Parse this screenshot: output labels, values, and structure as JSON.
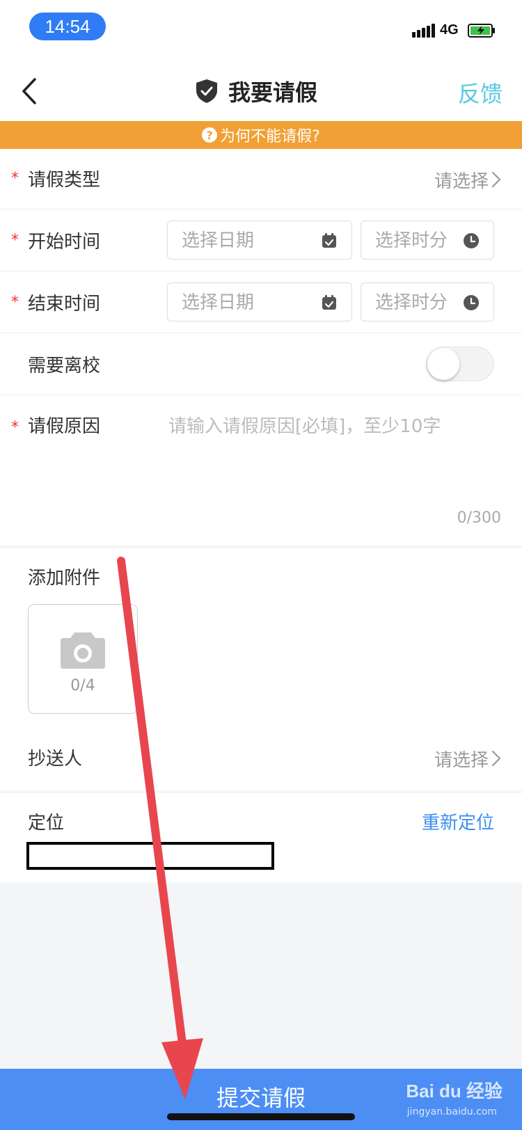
{
  "status": {
    "time": "14:54",
    "network": "4G"
  },
  "nav": {
    "title": "我要请假",
    "feedback": "反馈"
  },
  "banner": {
    "text": "为何不能请假?"
  },
  "form": {
    "leave_type": {
      "label": "请假类型",
      "value": "请选择"
    },
    "start_time": {
      "label": "开始时间",
      "date_placeholder": "选择日期",
      "time_placeholder": "选择时分"
    },
    "end_time": {
      "label": "结束时间",
      "date_placeholder": "选择日期",
      "time_placeholder": "选择时分"
    },
    "leave_school": {
      "label": "需要离校",
      "on": false
    },
    "reason": {
      "label": "请假原因",
      "placeholder": "请输入请假原因[必填]，至少10字",
      "counter": "0/300"
    },
    "attachment": {
      "label": "添加附件",
      "count": "0/4"
    },
    "cc": {
      "label": "抄送人",
      "value": "请选择"
    },
    "location": {
      "label": "定位",
      "action": "重新定位"
    }
  },
  "required_mark": "*",
  "submit": {
    "label": "提交请假"
  },
  "watermark": {
    "brand": "Bai du 经验",
    "site": "jingyan.baidu.com"
  },
  "colors": {
    "accent": "#4c8ef3",
    "banner": "#f0a035",
    "feedback": "#5ac8e3",
    "required": "#e33333",
    "arrow": "#e8464f"
  }
}
